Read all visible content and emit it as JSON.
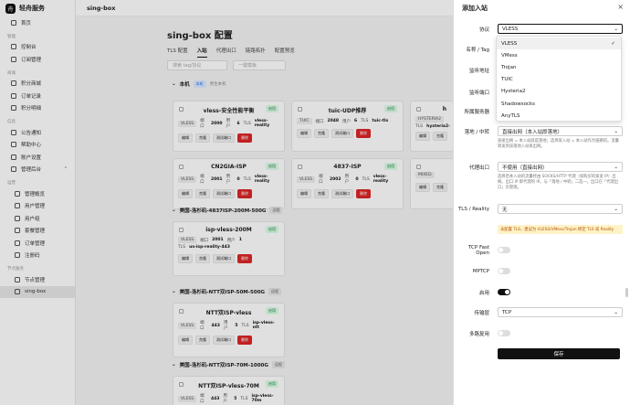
{
  "brand": {
    "name": "轻舟服务"
  },
  "sidebar": {
    "items": [
      {
        "label": "首页"
      },
      {
        "section": "管理"
      },
      {
        "label": "控制台"
      },
      {
        "label": "订阅管理"
      },
      {
        "section": "商城"
      },
      {
        "label": "积分商城"
      },
      {
        "label": "订单记录"
      },
      {
        "label": "积分明细"
      },
      {
        "section": "信息"
      },
      {
        "label": "公告通知"
      },
      {
        "label": "帮助中心"
      },
      {
        "label": "账户设置"
      },
      {
        "label": "管理后台"
      },
      {
        "section": "运营"
      },
      {
        "label": "管理概览"
      },
      {
        "label": "用户管理"
      },
      {
        "label": "用户组"
      },
      {
        "label": "套餐管理"
      },
      {
        "label": "订单管理"
      },
      {
        "label": "注册码"
      },
      {
        "section": "节点服务"
      },
      {
        "label": "节点管理"
      },
      {
        "label": "sing-box"
      }
    ]
  },
  "topbar": {
    "title": "sing-box"
  },
  "main": {
    "title": "sing-box 配置",
    "tabs": [
      "TLS 配置",
      "入站",
      "代理出口",
      "链路拓扑",
      "配置预览"
    ],
    "search_placeholder": "搜索 tag/协议",
    "filter_placeholder": "一键模板",
    "groups": [
      {
        "name": "本机",
        "tag": "本机",
        "sub": "原生本机"
      },
      {
        "name": "美国-洛杉矶-4837ISP-200M-500G",
        "tag": "远程"
      },
      {
        "name": "美国-洛杉矶-NTT双ISP-50M-500G",
        "tag": "远程"
      },
      {
        "name": "美国-洛杉矶-NTT双ISP-70M-1000G",
        "tag": "远程"
      }
    ],
    "cards": [
      {
        "name": "vless-安全性能平衡",
        "proto": "VLESS",
        "port_label": "端口",
        "port": "2000",
        "user_label": "用户",
        "users": "6",
        "tls": "TLS",
        "tls_name": "vless-reality"
      },
      {
        "name": "tuic-UDP推荐",
        "proto": "TUIC",
        "port_label": "端口",
        "port": "2048",
        "user_label": "用户",
        "users": "6",
        "tls": "TLS",
        "tls_name": "tuic-tls"
      },
      {
        "name": "h",
        "proto": "HYSTERIA2",
        "port_label": "",
        "port": "",
        "user_label": "",
        "users": "",
        "tls": "TLS",
        "tls_name": "hysteria2-"
      },
      {
        "name": "CN2GIA-ISP",
        "proto": "VLESS",
        "port_label": "端口",
        "port": "2001",
        "user_label": "用户",
        "users": "0",
        "tls": "TLS",
        "tls_name": "vless-reality"
      },
      {
        "name": "4837-ISP",
        "proto": "VLESS",
        "port_label": "端口",
        "port": "2002",
        "user_label": "用户",
        "users": "0",
        "tls": "TLS",
        "tls_name": "vless-reality"
      },
      {
        "name": "",
        "proto": "MIXED",
        "port_label": "",
        "port": "",
        "user_label": "",
        "users": "",
        "tls": "",
        "tls_name": ""
      },
      {
        "name": "isp-vless-200M",
        "proto": "VLESS",
        "port_label": "端口",
        "port": "2001",
        "user_label": "用户",
        "users": "1",
        "tls": "TLS",
        "tls_name": "us-isp-reality-443"
      },
      {
        "name": "NTT双ISP-vless",
        "proto": "VLESS",
        "port_label": "端口",
        "port": "443",
        "user_label": "用户",
        "users": "5",
        "tls": "TLS",
        "tls_name": "isp-vless-ntt"
      },
      {
        "name": "NTT双ISP-vless-70M",
        "proto": "VLESS",
        "port_label": "端口",
        "port": "443",
        "user_label": "用户",
        "users": "5",
        "tls": "TLS",
        "tls_name": "isp-vless-70m"
      }
    ],
    "card_actions": {
      "edit": "编辑",
      "copy": "克隆",
      "test": "测试端口",
      "delete": "删除"
    },
    "enabled": "启用"
  },
  "panel": {
    "title": "添加入站",
    "close": "×",
    "protocol_label": "协议",
    "protocol_value": "VLESS",
    "name_label": "名称 / Tag",
    "listen_label": "监听地址",
    "port_label": "监听端口",
    "server_label": "所属服务器",
    "landing_label": "落地 / 中转",
    "landing_value": "直接出网（本入站即落地）",
    "landing_hint": "直接出网 = 本入站就是落地；选择某入站 = 本入站作为链路的。流量转发到该落地入站再出网。",
    "proxy_label": "代理出口",
    "proxy_value": "不使用（直接出网）",
    "proxy_hint": "选择后本入站的流量经由 SOCKS/HTTP 代理（如购买的家宽 IP）出网。出口 IP 即代理的 IP。与「落地 / 中转」二选一。出口在「代理出口」页管理。",
    "tls_label": "TLS / Reality",
    "tls_value": "无",
    "tls_warn": "未配置 TLS，建议为 VLESS/VMess/Trojan 绑定 TLS 或 Reality",
    "fastopen_label": "TCP Fast Open",
    "mptcp_label": "MPTCP",
    "enable_label": "启用",
    "transport_label": "传输层",
    "transport_value": "TCP",
    "mux_label": "多路复用",
    "save": "保存",
    "options": [
      "VLESS",
      "VMess",
      "Trojan",
      "TUIC",
      "Hysteria2",
      "Shadowsocks",
      "AnyTLS"
    ]
  }
}
